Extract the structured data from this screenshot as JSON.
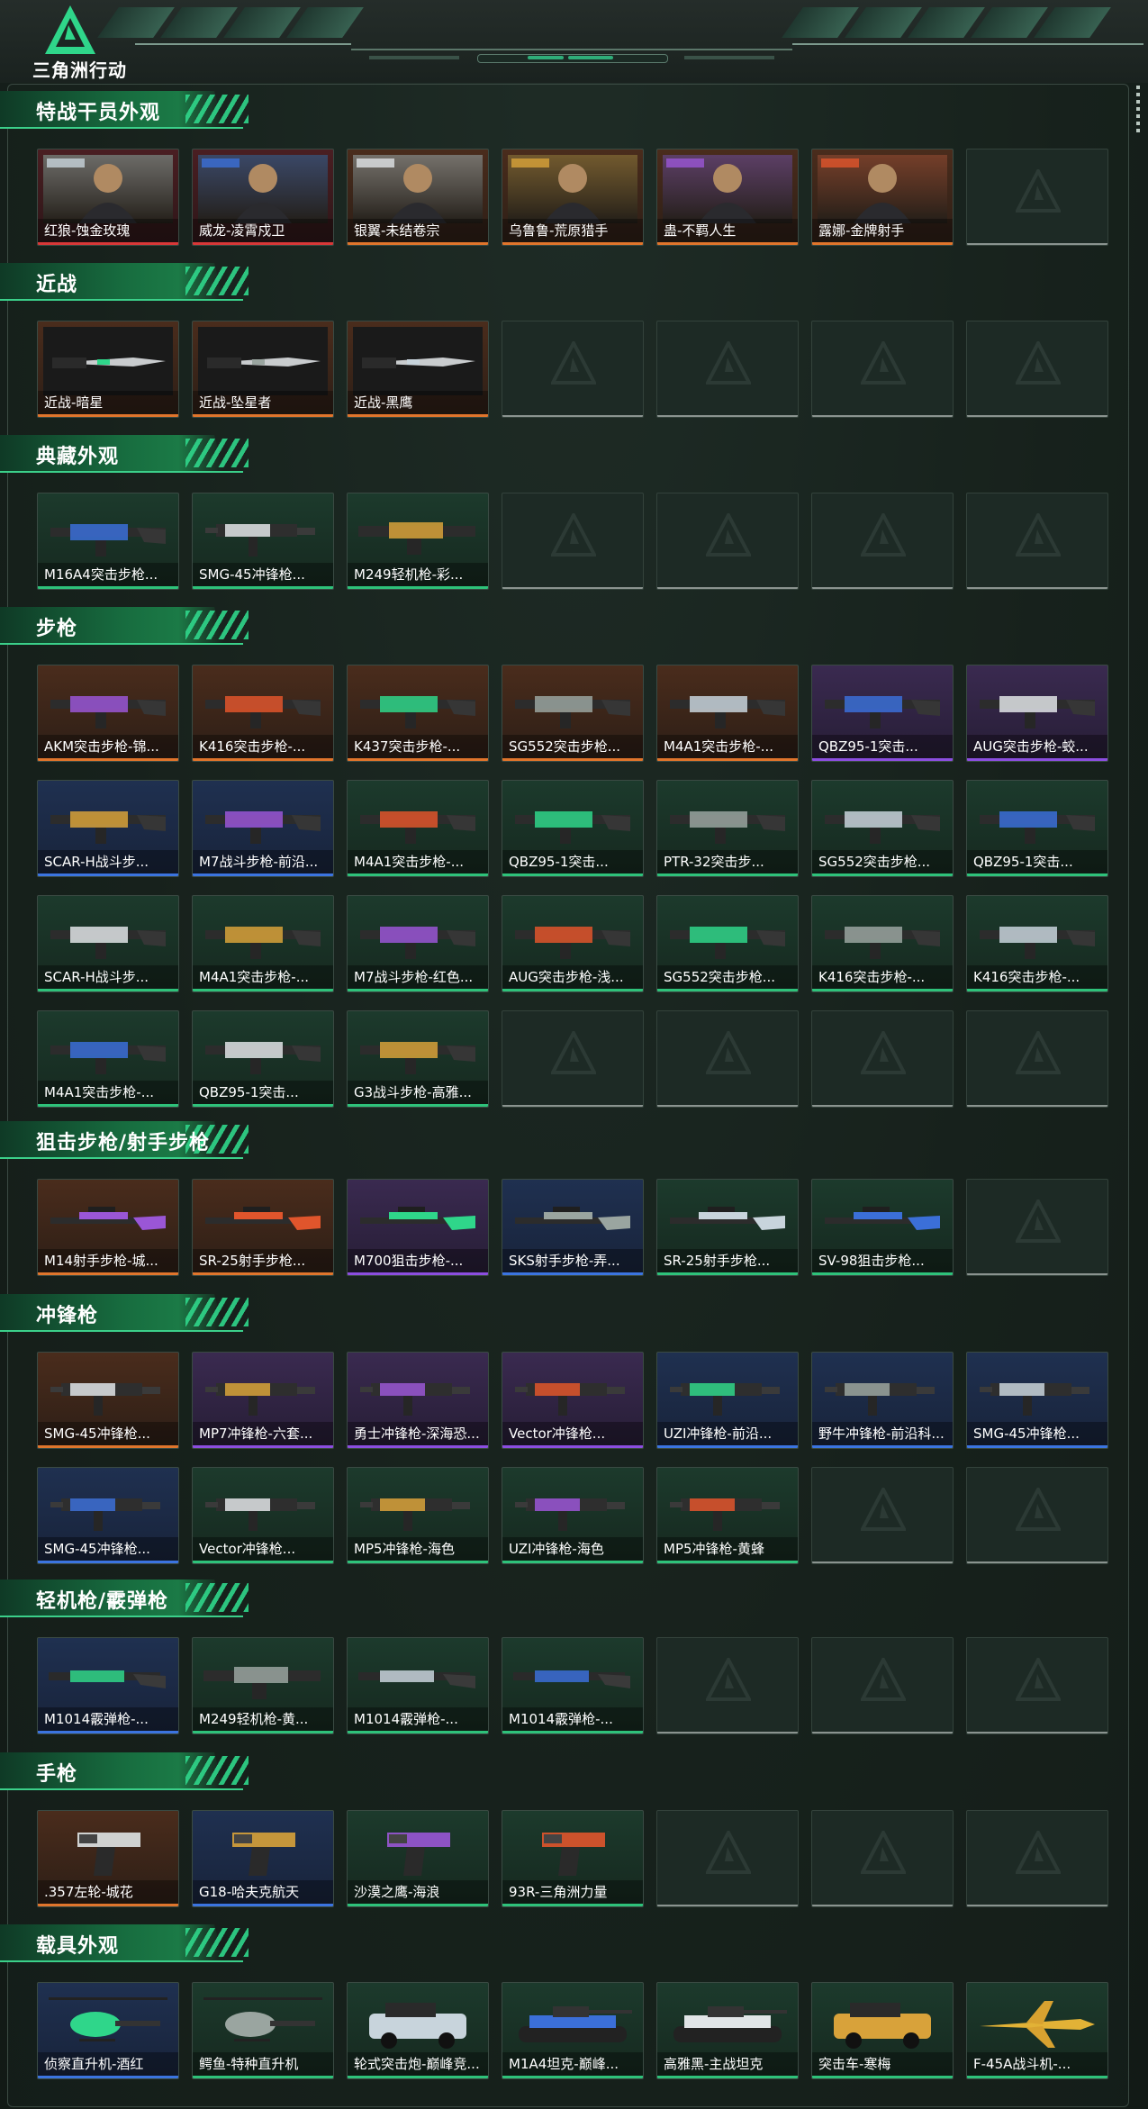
{
  "app": {
    "logo_text": "三角洲行动"
  },
  "sections": [
    {
      "title": "特战干员外观",
      "cards": [
        {
          "label": "红狼-蚀金玫瑰",
          "rarity": "red",
          "icon": "operator-portrait"
        },
        {
          "label": "威龙-凌霄戍卫",
          "rarity": "red",
          "icon": "operator-portrait"
        },
        {
          "label": "银翼-未结卷宗",
          "rarity": "orange",
          "icon": "operator-portrait"
        },
        {
          "label": "乌鲁鲁-荒原猎手",
          "rarity": "orange",
          "icon": "operator-portrait"
        },
        {
          "label": "蛊-不羁人生",
          "rarity": "orange",
          "icon": "operator-portrait"
        },
        {
          "label": "露娜-金牌射手",
          "rarity": "orange",
          "icon": "operator-portrait"
        },
        {
          "label": "",
          "rarity": "empty",
          "icon": "empty-slot"
        }
      ]
    },
    {
      "title": "近战",
      "cards": [
        {
          "label": "近战-暗星",
          "rarity": "orange",
          "icon": "knife"
        },
        {
          "label": "近战-坠星者",
          "rarity": "orange",
          "icon": "knife"
        },
        {
          "label": "近战-黑鹰",
          "rarity": "orange",
          "icon": "knife"
        },
        {
          "label": "",
          "rarity": "empty",
          "icon": "empty-slot"
        },
        {
          "label": "",
          "rarity": "empty",
          "icon": "empty-slot"
        },
        {
          "label": "",
          "rarity": "empty",
          "icon": "empty-slot"
        },
        {
          "label": "",
          "rarity": "empty",
          "icon": "empty-slot"
        }
      ]
    },
    {
      "title": "典藏外观",
      "cards": [
        {
          "label": "M16A4突击步枪...",
          "rarity": "green",
          "icon": "rifle"
        },
        {
          "label": "SMG-45冲锋枪...",
          "rarity": "green",
          "icon": "smg"
        },
        {
          "label": "M249轻机枪-彩...",
          "rarity": "green",
          "icon": "lmg"
        },
        {
          "label": "",
          "rarity": "empty",
          "icon": "empty-slot"
        },
        {
          "label": "",
          "rarity": "empty",
          "icon": "empty-slot"
        },
        {
          "label": "",
          "rarity": "empty",
          "icon": "empty-slot"
        },
        {
          "label": "",
          "rarity": "empty",
          "icon": "empty-slot"
        }
      ]
    },
    {
      "title": "步枪",
      "cards": [
        {
          "label": "AKM突击步枪-锦...",
          "rarity": "orange",
          "icon": "rifle"
        },
        {
          "label": "K416突击步枪-...",
          "rarity": "orange",
          "icon": "rifle"
        },
        {
          "label": "K437突击步枪-...",
          "rarity": "orange",
          "icon": "rifle"
        },
        {
          "label": "SG552突击步枪...",
          "rarity": "orange",
          "icon": "rifle"
        },
        {
          "label": "M4A1突击步枪-...",
          "rarity": "orange",
          "icon": "rifle"
        },
        {
          "label": "QBZ95-1突击...",
          "rarity": "purple",
          "icon": "rifle"
        },
        {
          "label": "AUG突击步枪-蛟...",
          "rarity": "purple",
          "icon": "rifle"
        },
        {
          "label": "SCAR-H战斗步...",
          "rarity": "blue",
          "icon": "rifle"
        },
        {
          "label": "M7战斗步枪-前沿...",
          "rarity": "blue",
          "icon": "rifle"
        },
        {
          "label": "M4A1突击步枪-...",
          "rarity": "green",
          "icon": "rifle"
        },
        {
          "label": "QBZ95-1突击...",
          "rarity": "green",
          "icon": "rifle"
        },
        {
          "label": "PTR-32突击步...",
          "rarity": "green",
          "icon": "rifle"
        },
        {
          "label": "SG552突击步枪...",
          "rarity": "green",
          "icon": "rifle"
        },
        {
          "label": "QBZ95-1突击...",
          "rarity": "green",
          "icon": "rifle"
        },
        {
          "label": "SCAR-H战斗步...",
          "rarity": "green",
          "icon": "rifle"
        },
        {
          "label": "M4A1突击步枪-...",
          "rarity": "green",
          "icon": "rifle"
        },
        {
          "label": "M7战斗步枪-红色...",
          "rarity": "green",
          "icon": "rifle"
        },
        {
          "label": "AUG突击步枪-浅...",
          "rarity": "green",
          "icon": "rifle"
        },
        {
          "label": "SG552突击步枪...",
          "rarity": "green",
          "icon": "rifle"
        },
        {
          "label": "K416突击步枪-...",
          "rarity": "green",
          "icon": "rifle"
        },
        {
          "label": "K416突击步枪-...",
          "rarity": "green",
          "icon": "rifle"
        },
        {
          "label": "M4A1突击步枪-...",
          "rarity": "green",
          "icon": "rifle"
        },
        {
          "label": "QBZ95-1突击...",
          "rarity": "green",
          "icon": "rifle"
        },
        {
          "label": "G3战斗步枪-高雅...",
          "rarity": "green",
          "icon": "rifle"
        },
        {
          "label": "",
          "rarity": "empty",
          "icon": "empty-slot"
        },
        {
          "label": "",
          "rarity": "empty",
          "icon": "empty-slot"
        },
        {
          "label": "",
          "rarity": "empty",
          "icon": "empty-slot"
        },
        {
          "label": "",
          "rarity": "empty",
          "icon": "empty-slot"
        }
      ]
    },
    {
      "title": "狙击步枪/射手步枪",
      "cards": [
        {
          "label": "M14射手步枪-城...",
          "rarity": "orange",
          "icon": "sniper"
        },
        {
          "label": "SR-25射手步枪...",
          "rarity": "orange",
          "icon": "sniper"
        },
        {
          "label": "M700狙击步枪-...",
          "rarity": "purple",
          "icon": "sniper"
        },
        {
          "label": "SKS射手步枪-弄...",
          "rarity": "blue",
          "icon": "sniper"
        },
        {
          "label": "SR-25射手步枪...",
          "rarity": "green",
          "icon": "sniper"
        },
        {
          "label": "SV-98狙击步枪...",
          "rarity": "green",
          "icon": "sniper"
        },
        {
          "label": "",
          "rarity": "empty",
          "icon": "empty-slot"
        }
      ]
    },
    {
      "title": "冲锋枪",
      "cards": [
        {
          "label": "SMG-45冲锋枪...",
          "rarity": "orange",
          "icon": "smg"
        },
        {
          "label": "MP7冲锋枪-六套...",
          "rarity": "purple",
          "icon": "smg"
        },
        {
          "label": "勇士冲锋枪-深海恐...",
          "rarity": "purple",
          "icon": "smg"
        },
        {
          "label": "Vector冲锋枪...",
          "rarity": "purple",
          "icon": "smg"
        },
        {
          "label": "UZI冲锋枪-前沿...",
          "rarity": "blue",
          "icon": "smg"
        },
        {
          "label": "野牛冲锋枪-前沿科...",
          "rarity": "blue",
          "icon": "smg"
        },
        {
          "label": "SMG-45冲锋枪...",
          "rarity": "blue",
          "icon": "smg"
        },
        {
          "label": "SMG-45冲锋枪...",
          "rarity": "blue",
          "icon": "smg"
        },
        {
          "label": "Vector冲锋枪...",
          "rarity": "green",
          "icon": "smg"
        },
        {
          "label": "MP5冲锋枪-海色",
          "rarity": "green",
          "icon": "smg"
        },
        {
          "label": "UZI冲锋枪-海色",
          "rarity": "green",
          "icon": "smg"
        },
        {
          "label": "MP5冲锋枪-黄蜂",
          "rarity": "green",
          "icon": "smg"
        },
        {
          "label": "",
          "rarity": "empty",
          "icon": "empty-slot"
        },
        {
          "label": "",
          "rarity": "empty",
          "icon": "empty-slot"
        }
      ]
    },
    {
      "title": "轻机枪/霰弹枪",
      "cards": [
        {
          "label": "M1014霰弹枪-...",
          "rarity": "blue",
          "icon": "shotgun"
        },
        {
          "label": "M249轻机枪-黄...",
          "rarity": "green",
          "icon": "lmg"
        },
        {
          "label": "M1014霰弹枪-...",
          "rarity": "green",
          "icon": "shotgun"
        },
        {
          "label": "M1014霰弹枪-...",
          "rarity": "green",
          "icon": "shotgun"
        },
        {
          "label": "",
          "rarity": "empty",
          "icon": "empty-slot"
        },
        {
          "label": "",
          "rarity": "empty",
          "icon": "empty-slot"
        },
        {
          "label": "",
          "rarity": "empty",
          "icon": "empty-slot"
        }
      ]
    },
    {
      "title": "手枪",
      "cards": [
        {
          "label": ".357左轮-城花",
          "rarity": "orange",
          "icon": "pistol"
        },
        {
          "label": "G18-哈夫克航天",
          "rarity": "blue",
          "icon": "pistol"
        },
        {
          "label": "沙漠之鹰-海浪",
          "rarity": "green",
          "icon": "pistol"
        },
        {
          "label": "93R-三角洲力量",
          "rarity": "green",
          "icon": "pistol"
        },
        {
          "label": "",
          "rarity": "empty",
          "icon": "empty-slot"
        },
        {
          "label": "",
          "rarity": "empty",
          "icon": "empty-slot"
        },
        {
          "label": "",
          "rarity": "empty",
          "icon": "empty-slot"
        }
      ]
    },
    {
      "title": "载具外观",
      "cards": [
        {
          "label": "侦察直升机-酒红",
          "rarity": "blue",
          "icon": "helicopter"
        },
        {
          "label": "鳄鱼-特种直升机",
          "rarity": "green",
          "icon": "helicopter"
        },
        {
          "label": "轮式突击炮-巅峰竞...",
          "rarity": "green",
          "icon": "vehicle"
        },
        {
          "label": "M1A4坦克-巅峰...",
          "rarity": "green",
          "icon": "tank"
        },
        {
          "label": "高雅黑-主战坦克",
          "rarity": "green",
          "icon": "tank"
        },
        {
          "label": "突击车-寒梅",
          "rarity": "green",
          "icon": "vehicle"
        },
        {
          "label": "F-45A战斗机-...",
          "rarity": "green",
          "icon": "jet"
        }
      ]
    }
  ]
}
